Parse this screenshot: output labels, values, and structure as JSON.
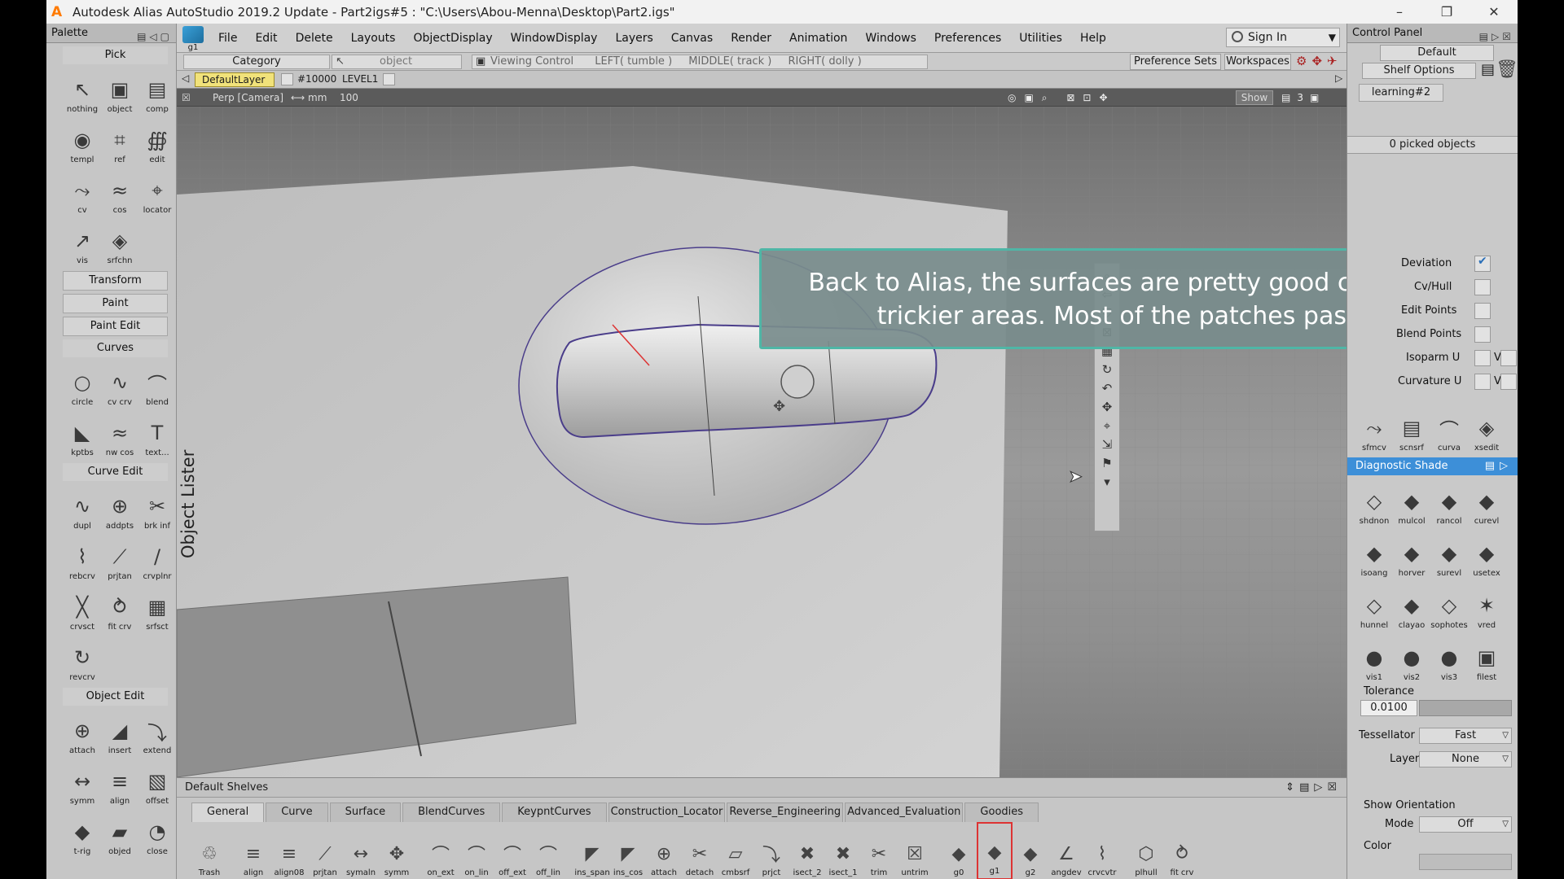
{
  "app": {
    "title": "Autodesk Alias AutoStudio 2019.2 Update   - Part2igs#5 : \"C:\\Users\\Abou-Menna\\Desktop\\Part2.igs\"",
    "window_controls": [
      "–",
      "❐",
      "✕"
    ],
    "accent": "#ff7a00"
  },
  "palette": {
    "title": "Palette",
    "pick": {
      "title": "Pick",
      "tools": [
        {
          "label": "nothing",
          "icon": "↖"
        },
        {
          "label": "object",
          "icon": "▣"
        },
        {
          "label": "comp",
          "icon": "▤"
        },
        {
          "label": "templ",
          "icon": "◉"
        },
        {
          "label": "ref",
          "icon": "⌗"
        },
        {
          "label": "edit",
          "icon": "∰"
        },
        {
          "label": "cv",
          "icon": "⤳"
        },
        {
          "label": "cos",
          "icon": "≈"
        },
        {
          "label": "locator",
          "icon": "⌖"
        },
        {
          "label": "vis",
          "icon": "↗"
        },
        {
          "label": "srfchn",
          "icon": "◈"
        }
      ]
    },
    "transform": "Transform",
    "paint": "Paint",
    "paint_edit": "Paint Edit",
    "curves": {
      "title": "Curves",
      "tools": [
        {
          "label": "circle",
          "icon": "○"
        },
        {
          "label": "cv crv",
          "icon": "∿"
        },
        {
          "label": "blend",
          "icon": "⌒"
        },
        {
          "label": "kptbs",
          "icon": "◣"
        },
        {
          "label": "nw cos",
          "icon": "≈"
        },
        {
          "label": "text...",
          "icon": "T"
        }
      ]
    },
    "curve_edit": {
      "title": "Curve Edit",
      "tools": [
        {
          "label": "dupl",
          "icon": "∿"
        },
        {
          "label": "addpts",
          "icon": "⊕"
        },
        {
          "label": "brk inf",
          "icon": "✂"
        },
        {
          "label": "rebcrv",
          "icon": "⌇"
        },
        {
          "label": "prjtan",
          "icon": "⟋"
        },
        {
          "label": "crvplnr",
          "icon": "∕"
        },
        {
          "label": "crvsct",
          "icon": "╳"
        },
        {
          "label": "fit crv",
          "icon": "⥁"
        },
        {
          "label": "srfsct",
          "icon": "▦"
        },
        {
          "label": "revcrv",
          "icon": "↻"
        }
      ]
    },
    "object_edit": {
      "title": "Object Edit",
      "tools": [
        {
          "label": "attach",
          "icon": "⊕"
        },
        {
          "label": "insert",
          "icon": "◢"
        },
        {
          "label": "extend",
          "icon": "⤵"
        },
        {
          "label": "symm",
          "icon": "↔"
        },
        {
          "label": "align",
          "icon": "≡"
        },
        {
          "label": "offset",
          "icon": "▧"
        },
        {
          "label": "t-rig",
          "icon": "◆"
        },
        {
          "label": "objed",
          "icon": "▰"
        },
        {
          "label": "close",
          "icon": "◔"
        }
      ]
    }
  },
  "menubar": {
    "g1_label": "g1",
    "items": [
      "File",
      "Edit",
      "Delete",
      "Layouts",
      "ObjectDisplay",
      "WindowDisplay",
      "Layers",
      "Canvas",
      "Render",
      "Animation",
      "Windows",
      "Preferences",
      "Utilities",
      "Help"
    ],
    "sign_in": "Sign In"
  },
  "toolbar": {
    "category_label": "Category",
    "category_value": "object",
    "viewing_control": "Viewing Control",
    "left": "LEFT( tumble )",
    "middle": "MIDDLE( track )",
    "right": "RIGHT( dolly )",
    "preference_sets": "Preference Sets",
    "workspaces": "Workspaces"
  },
  "layers": {
    "default_layer": "DefaultLayer",
    "layer_id": "#10000",
    "layer_name": "LEVEL1"
  },
  "viewport": {
    "camera": "Perp [Camera]",
    "units": "⟷ mm",
    "scale": "100",
    "show": "Show",
    "object_lister": "Object Lister",
    "caption": "Back to Alias, the surfaces are pretty good continuites, even in trickier areas. Most of the patches pass the check..."
  },
  "shelves": {
    "title": "Default Shelves",
    "tabs": [
      "General",
      "Curve",
      "Surface",
      "BlendCurves",
      "KeypntCurves",
      "Construction_Locator",
      "Reverse_Engineering",
      "Advanced_Evaluation",
      "Goodies"
    ],
    "tools": [
      {
        "label": "Trash",
        "icon": "♲"
      },
      {
        "label": "align",
        "icon": "≡"
      },
      {
        "label": "align08",
        "icon": "≡"
      },
      {
        "label": "prjtan",
        "icon": "⟋"
      },
      {
        "label": "symaln",
        "icon": "↔"
      },
      {
        "label": "symm",
        "icon": "✥"
      },
      {
        "label": "on_ext",
        "icon": "⌒"
      },
      {
        "label": "on_lin",
        "icon": "⌒"
      },
      {
        "label": "off_ext",
        "icon": "⌒"
      },
      {
        "label": "off_lin",
        "icon": "⌒"
      },
      {
        "label": "ins_span",
        "icon": "◤"
      },
      {
        "label": "ins_cos",
        "icon": "◤"
      },
      {
        "label": "attach",
        "icon": "⊕"
      },
      {
        "label": "detach",
        "icon": "✂"
      },
      {
        "label": "cmbsrf",
        "icon": "▱"
      },
      {
        "label": "prjct",
        "icon": "⤵"
      },
      {
        "label": "isect_2",
        "icon": "✖"
      },
      {
        "label": "isect_1",
        "icon": "✖"
      },
      {
        "label": "trim",
        "icon": "✂"
      },
      {
        "label": "untrim",
        "icon": "☒"
      },
      {
        "label": "g0",
        "icon": "◆"
      },
      {
        "label": "g1",
        "icon": "◆"
      },
      {
        "label": "g2",
        "icon": "◆"
      },
      {
        "label": "angdev",
        "icon": "∠"
      },
      {
        "label": "crvcvtr",
        "icon": "⌇"
      },
      {
        "label": "plhull",
        "icon": "⬡"
      },
      {
        "label": "fit crv",
        "icon": "⥁"
      }
    ]
  },
  "control_panel": {
    "title": "Control Panel",
    "default": "Default",
    "shelf_options": "Shelf Options",
    "shelf_tab": "learning#2",
    "picked": "0 picked objects",
    "deviation": "Deviation",
    "cvhull": "Cv/Hull",
    "edit_points": "Edit Points",
    "blend_points": "Blend Points",
    "isoparm_u": "Isoparm U",
    "curvature_u": "Curvature U",
    "v": "V",
    "top_tools": [
      {
        "label": "sfmcv",
        "icon": "⤳"
      },
      {
        "label": "scnsrf",
        "icon": "▤"
      },
      {
        "label": "curva",
        "icon": "⌒"
      },
      {
        "label": "xsedit",
        "icon": "◈"
      }
    ],
    "diagnostic": {
      "title": "Diagnostic Shade",
      "tools": [
        {
          "label": "shdnon",
          "icon": "◇"
        },
        {
          "label": "mulcol",
          "icon": "◆"
        },
        {
          "label": "rancol",
          "icon": "◆"
        },
        {
          "label": "curevl",
          "icon": "◆"
        },
        {
          "label": "isoang",
          "icon": "◆"
        },
        {
          "label": "horver",
          "icon": "◆"
        },
        {
          "label": "surevl",
          "icon": "◆"
        },
        {
          "label": "usetex",
          "icon": "◆"
        },
        {
          "label": "hunnel",
          "icon": "◇"
        },
        {
          "label": "clayao",
          "icon": "◆"
        },
        {
          "label": "sophotes",
          "icon": "◇"
        },
        {
          "label": "vred",
          "icon": "✶"
        },
        {
          "label": "vis1",
          "icon": "●"
        },
        {
          "label": "vis2",
          "icon": "●"
        },
        {
          "label": "vis3",
          "icon": "●"
        },
        {
          "label": "filest",
          "icon": "▣"
        }
      ]
    },
    "tolerance_label": "Tolerance",
    "tolerance_value": "0.0100",
    "tessellator_label": "Tessellator",
    "tessellator_value": "Fast",
    "layer_label": "Layer",
    "layer_value": "None",
    "show_orientation": "Show Orientation",
    "mode_label": "Mode",
    "mode_value": "Off",
    "color_label": "Color"
  }
}
